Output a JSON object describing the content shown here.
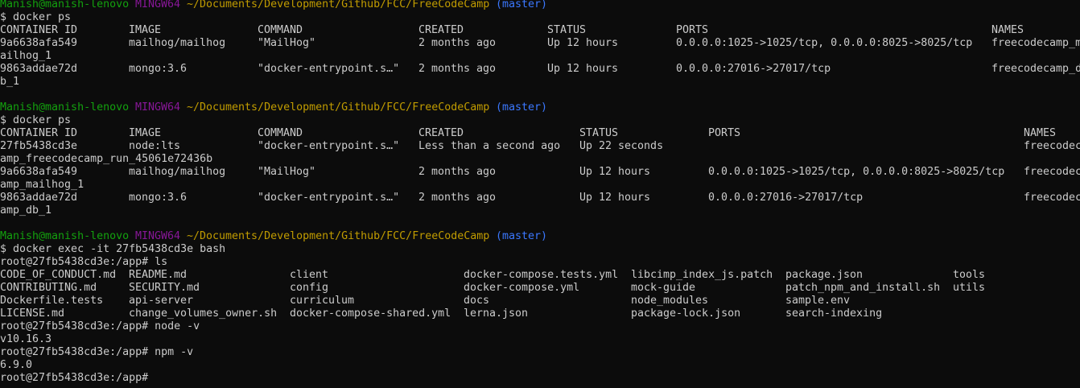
{
  "terminal": {
    "prompt_1": {
      "user": "Manish@manish-lenovo",
      "env": "MINGW64",
      "path": "~/Documents/Development/Github/FCC/FreeCodeCamp",
      "branch": "(master)"
    },
    "cmd_1": "$ docker ps",
    "table_1": {
      "headers": [
        "CONTAINER ID",
        "IMAGE",
        "COMMAND",
        "CREATED",
        "STATUS",
        "PORTS",
        "NAMES"
      ],
      "rows": [
        [
          "9a6638afa549",
          "mailhog/mailhog",
          "\"MailHog\"",
          "2 months ago",
          "Up 12 hours",
          "0.0.0.0:1025->1025/tcp, 0.0.0.0:8025->8025/tcp",
          "freecodecamp_m"
        ],
        [
          "9863addae72d",
          "mongo:3.6",
          "\"docker-entrypoint.s…\"",
          "2 months ago",
          "Up 12 hours",
          "0.0.0.0:27016->27017/tcp",
          "freecodecamp_d"
        ]
      ],
      "wraps": [
        "ailhog_1",
        "b_1"
      ]
    },
    "prompt_2": {
      "user": "Manish@manish-lenovo",
      "env": "MINGW64",
      "path": "~/Documents/Development/Github/FCC/FreeCodeCamp",
      "branch": "(master)"
    },
    "cmd_2": "$ docker ps",
    "table_2": {
      "headers": [
        "CONTAINER ID",
        "IMAGE",
        "COMMAND",
        "CREATED",
        "STATUS",
        "PORTS",
        "NAMES"
      ],
      "rows": [
        [
          "27fb5438cd3e",
          "node:lts",
          "\"docker-entrypoint.s…\"",
          "Less than a second ago",
          "Up 22 seconds",
          "",
          "freecodec"
        ],
        [
          "9a6638afa549",
          "mailhog/mailhog",
          "\"MailHog\"",
          "2 months ago",
          "Up 12 hours",
          "0.0.0.0:1025->1025/tcp, 0.0.0.0:8025->8025/tcp",
          "freecodec"
        ],
        [
          "9863addae72d",
          "mongo:3.6",
          "\"docker-entrypoint.s…\"",
          "2 months ago",
          "Up 12 hours",
          "0.0.0.0:27016->27017/tcp",
          "freecodec"
        ]
      ],
      "wraps": [
        "amp_freecodecamp_run_45061e72436b",
        "amp_mailhog_1",
        "amp_db_1"
      ]
    },
    "prompt_3": {
      "user": "Manish@manish-lenovo",
      "env": "MINGW64",
      "path": "~/Documents/Development/Github/FCC/FreeCodeCamp",
      "branch": "(master)"
    },
    "cmd_3": "$ docker exec -it 27fb5438cd3e bash",
    "cmd_ls": "root@27fb5438cd3e:/app# ls",
    "ls_rows": [
      [
        "CODE_OF_CONDUCT.md",
        "README.md",
        "client",
        "docker-compose.tests.yml",
        "libcimp_index_js.patch",
        "package.json",
        "tools"
      ],
      [
        "CONTRIBUTING.md",
        "SECURITY.md",
        "config",
        "docker-compose.yml",
        "mock-guide",
        "patch_npm_and_install.sh",
        "utils"
      ],
      [
        "Dockerfile.tests",
        "api-server",
        "curriculum",
        "docs",
        "node_modules",
        "sample.env",
        ""
      ],
      [
        "LICENSE.md",
        "change_volumes_owner.sh",
        "docker-compose-shared.yml",
        "lerna.json",
        "package-lock.json",
        "search-indexing",
        ""
      ]
    ],
    "cmd_node": "root@27fb5438cd3e:/app# node -v",
    "out_node": "v10.16.3",
    "cmd_npm": "root@27fb5438cd3e:/app# npm -v",
    "out_npm": "6.9.0",
    "final_prompt": "root@27fb5438cd3e:/app#"
  },
  "colors": {
    "background": "#0c0c0c",
    "text": "#cccccc",
    "user": "#13a10e",
    "env": "#881798",
    "path": "#c19c00",
    "branch": "#3b78ff"
  }
}
